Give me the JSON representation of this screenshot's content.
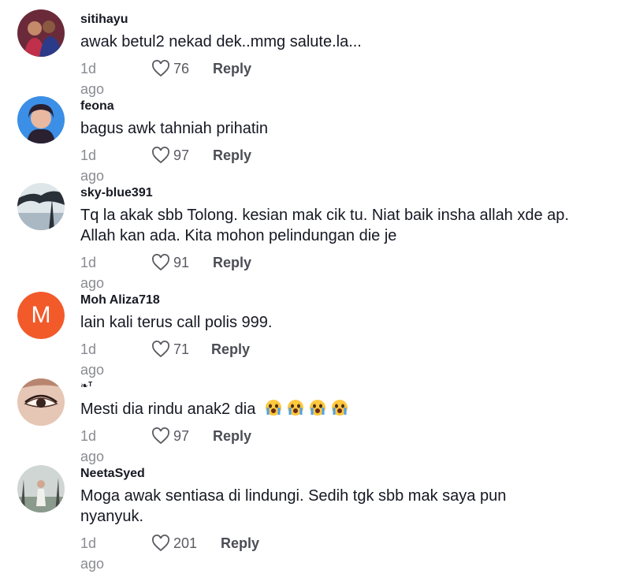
{
  "comments": [
    {
      "username": "sitihayu",
      "text": "awak betul2 nekad dek..mmg salute.la...",
      "time": "1d ago",
      "likes": "76",
      "reply": "Reply"
    },
    {
      "username": "feona",
      "text": "bagus awk tahniah prihatin",
      "time": "1d ago",
      "likes": "97",
      "reply": "Reply"
    },
    {
      "username": "sky-blue391",
      "text_line1": "Tq la akak sbb Tolong. kesian mak cik tu. Niat baik insha allah xde ap.",
      "text_line2": "Allah kan ada. Kita mohon pelindungan die je",
      "time": "1d ago",
      "likes": "91",
      "reply": "Reply"
    },
    {
      "username": "Moh Aliza718",
      "avatar_letter": "M",
      "text": "lain kali terus call polis 999.",
      "time": "1d ago",
      "likes": "71",
      "reply": "Reply"
    },
    {
      "username": "❧ᵀ",
      "text": "Mesti dia rindu anak2 dia",
      "emojis": [
        "crying-face-icon",
        "crying-face-icon",
        "crying-face-icon",
        "crying-face-icon"
      ],
      "time": "1d ago",
      "likes": "97",
      "reply": "Reply"
    },
    {
      "username": "NeetaSyed",
      "text_line1": "Moga awak sentiasa di lindungi. Sedih tgk sbb mak saya pun",
      "text_line2": "nyanyuk.",
      "time": "1d ago",
      "likes": "201",
      "reply": "Reply"
    }
  ],
  "colors": {
    "avatar_m": "#f25a2a",
    "meta_gray": "#8a8b91",
    "text": "#161823"
  }
}
